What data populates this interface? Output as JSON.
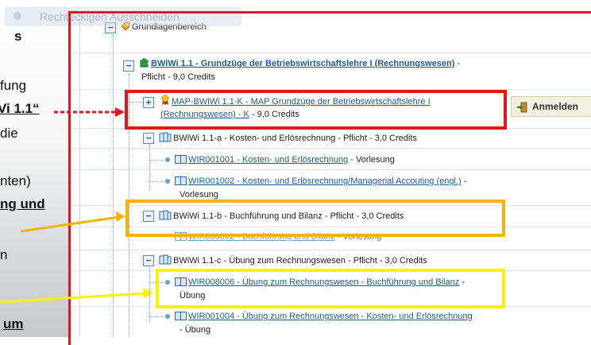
{
  "slide": {
    "lines": [
      "s",
      "fung",
      "Vi 1.1“",
      "die",
      "nten)",
      "ng und",
      "n",
      "um"
    ]
  },
  "overlay": {
    "label": "Rechteckigen Ausschneiden"
  },
  "tree": {
    "root": {
      "label": "Grundlagenbereich"
    },
    "module": {
      "link": "BWiWi 1.1 - Grundzüge der Betriebswirtschaftslehre I (Rechnungswesen)",
      "suffix_inline": " -",
      "suffix_line2": "Pflicht - 9,0 Credits"
    },
    "exam": {
      "link_line1": "MAP-BWiWi 1.1-K - MAP Grundzüge der Betriebswirtschaftslehre I",
      "link_line2": "(Rechnungswesen) - K",
      "suffix": " - 9,0 Credits"
    },
    "action_button": {
      "label": "Anmelden"
    },
    "group_a": {
      "label": "BWiWi 1.1-a - Kosten- und Erlösrechnung - Pflicht - 3,0 Credits",
      "items": [
        {
          "link": "WIR001001 - Kosten- und Erlösrechnung",
          "suffix": " - Vorlesung",
          "suffix_line2": ""
        },
        {
          "link": "WIR001002 - Kosten- und Erlösrechnung/Managerial Accouting (engl.)",
          "suffix": " -",
          "suffix_line2": "Vorlesung"
        }
      ]
    },
    "group_b": {
      "label": "BWiWi 1.1-b - Buchführung und Bilanz - Pflicht - 3,0 Credits",
      "items": [
        {
          "link": "WIR008002 - Buchführung und Bilanz",
          "suffix": " - Vorlesung"
        }
      ]
    },
    "group_c": {
      "label": "BWiWi 1.1-c - Übung zum Rechnungswesen - Pflicht - 3,0 Credits",
      "items": [
        {
          "link": "WIR008006 - Übung zum Rechnungswesen - Buchführung und Bilanz",
          "suffix": " -",
          "suffix_line2": "Übung"
        },
        {
          "link": "WIR001004 - Übung zum Rechnungswesen - Kosten- und Erlösrechnung",
          "suffix": "",
          "suffix_line2": "- Übung"
        }
      ]
    }
  },
  "colors": {
    "highlight_red": "#e8131b",
    "highlight_orange": "#f5b400",
    "highlight_yellow": "#fff200",
    "link": "#1f5b94"
  }
}
